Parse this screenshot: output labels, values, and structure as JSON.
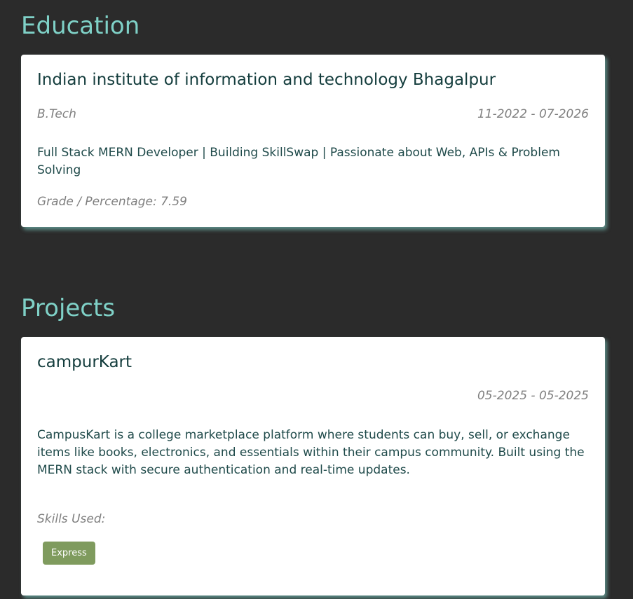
{
  "education": {
    "section_title": "Education",
    "institution": "Indian institute of information and technology Bhagalpur",
    "degree": "B.Tech",
    "date_range": "11-2022 - 07-2026",
    "description": "Full Stack MERN Developer | Building SkillSwap | Passionate about Web, APIs & Problem Solving",
    "grade": "Grade / Percentage: 7.59"
  },
  "projects": {
    "section_title": "Projects",
    "items": [
      {
        "name": "campurKart",
        "date_range": "05-2025 - 05-2025",
        "description": "CampusKart is a college marketplace platform where students can buy, sell, or exchange items like books, electronics, and essentials within their campus community. Built using the MERN stack with secure authentication and real-time updates.",
        "skills_label": "Skills Used:",
        "skills": [
          "Express"
        ]
      }
    ]
  },
  "colors": {
    "background": "#2b2b2b",
    "accent": "#7fd1c7",
    "card": "#ffffff",
    "heading_text": "#143d3d",
    "muted_text": "#808080",
    "skill_chip": "#7f9b5e"
  }
}
